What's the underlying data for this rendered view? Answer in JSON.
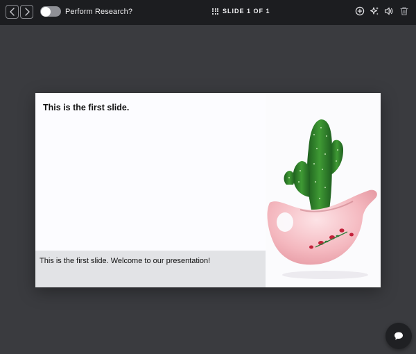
{
  "toolbar": {
    "toggle_label": "Perform Research?",
    "toggle_on": false,
    "slide_counter": "SLIDE 1 OF 1",
    "icons": {
      "back": "chevron-left-icon",
      "forward": "chevron-right-icon",
      "slides": "grid-icon",
      "add": "plus-circle-icon",
      "ai": "sparkles-icon",
      "audio": "speaker-icon",
      "delete": "trash-icon"
    }
  },
  "slide": {
    "title": "This is the first slide.",
    "caption": "This is the first slide. Welcome to our presentation!",
    "image": "cactus-in-pink-pot"
  },
  "chat": {
    "icon": "chat-bubble-icon"
  },
  "colors": {
    "toolbar_bg": "#1c1d20",
    "canvas_bg": "#3a3b3f",
    "slide_bg": "#fcfcff",
    "caption_bar_bg": "#e2e3e6"
  }
}
